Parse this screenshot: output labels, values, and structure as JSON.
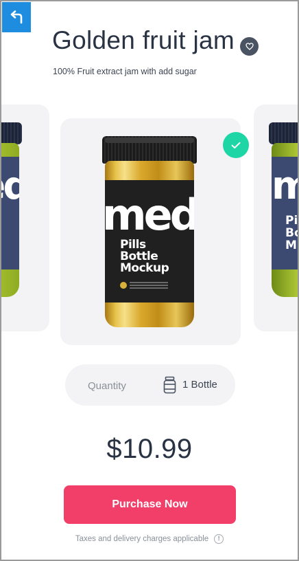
{
  "header": {
    "title": "Golden fruit jam",
    "subtitle": "100% Fruit extract jam with add sugar",
    "back_icon": "back-arrow-icon",
    "favorite_icon": "heart-icon"
  },
  "carousel": {
    "selected_icon": "check-icon",
    "main_product": {
      "label_big": "med",
      "label_lines": [
        "Pills",
        "Bottle",
        "Mockup"
      ]
    },
    "left_product": {
      "label_big": "med"
    },
    "right_product": {
      "label_big": "med",
      "label_lines": [
        "Pi",
        "Bo",
        "M"
      ]
    }
  },
  "quantity": {
    "label": "Quantity",
    "value": "1 Bottle",
    "icon": "bottle-icon"
  },
  "price": "$10.99",
  "purchase_button": "Purchase Now",
  "footer": {
    "note": "Taxes and delivery charges applicable",
    "info_icon": "info-icon",
    "info_glyph": "!"
  },
  "colors": {
    "accent": "#f23f6a",
    "check": "#1ed6a5",
    "back_button": "#1e8de0",
    "text_dark": "#2a3343"
  }
}
